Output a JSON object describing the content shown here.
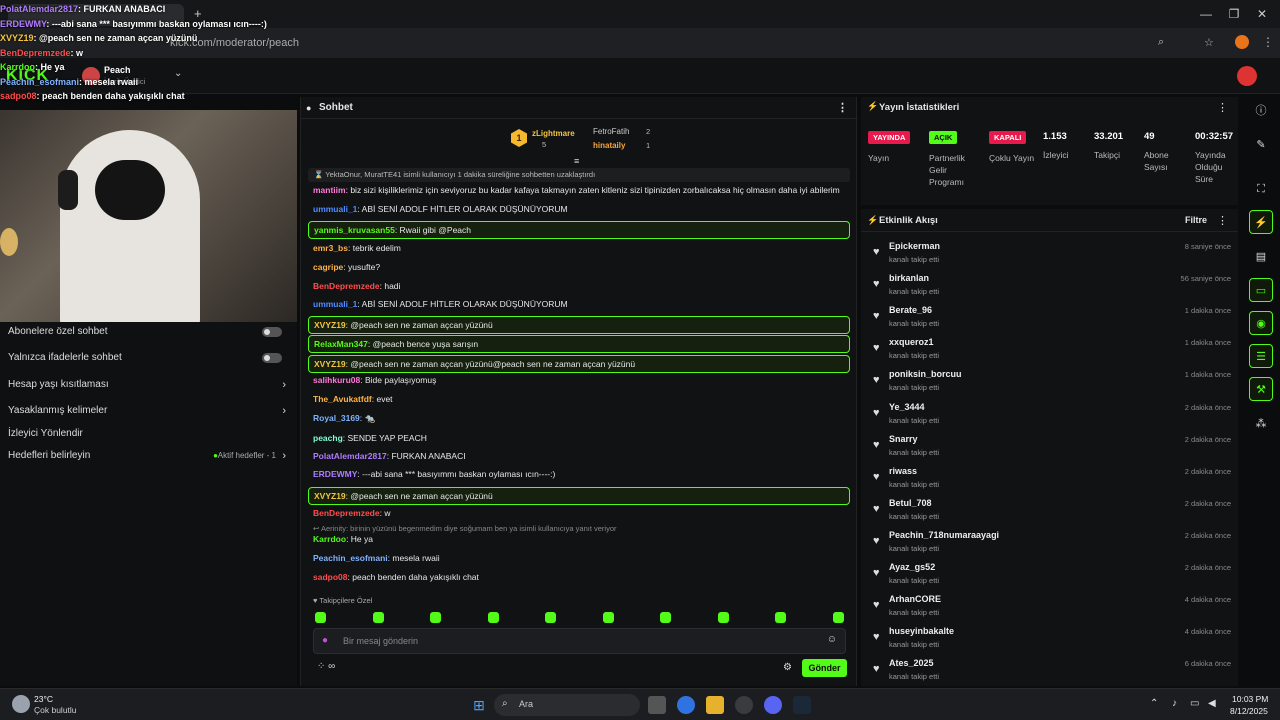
{
  "browser": {
    "tab_label": "PolatAlemdar2817: FURKAN ANABACI",
    "new_tab": "+",
    "url": "kick.com/moderator/peach",
    "controls": {
      "minimize": "—",
      "maximize": "❐",
      "close": "✕"
    }
  },
  "kick": {
    "logo": "KICK",
    "channel": "Peach",
    "channel_sub": "İçerik Üretici"
  },
  "overlay_chat": [
    {
      "user": "PolatAlemdar2817",
      "text": ": FURKAN ANABACI",
      "color": "#b07cff"
    },
    {
      "user": "ERDEWMY",
      "text": ": ---abi sana *** basıyımmı baskan oylaması ıcın----:)",
      "color": "#b07cff"
    },
    {
      "user": "XVYZ19",
      "text": ": @peach sen ne zaman açcan yüzünü",
      "color": "#f5c542"
    },
    {
      "user": "BenDepremzede",
      "text": ": w",
      "color": "#ff4d4d"
    },
    {
      "user": "Karrdoo",
      "text": ": He ya",
      "color": "#53fc18"
    },
    {
      "user": "Peachin_esofmani",
      "text": ": mesela rwaii",
      "color": "#7fb3ff"
    },
    {
      "user": "sadpo08",
      "text": ": peach benden daha yakışıklı chat",
      "color": "#ff4d4d"
    }
  ],
  "left_panel": {
    "items": [
      {
        "label": "Abonelere özel sohbet",
        "kind": "toggle"
      },
      {
        "label": "Yalnızca ifadelerle sohbet",
        "kind": "toggle"
      },
      {
        "label": "Hesap yaşı kısıtlaması",
        "kind": "chevron"
      },
      {
        "label": "Yasaklanmış kelimeler",
        "kind": "chevron"
      },
      {
        "label": "İzleyici Yönlendir",
        "kind": "none"
      },
      {
        "label": "Hedefleri belirleyin",
        "kind": "chevron",
        "extra": "Aktif hedefler - 1"
      }
    ]
  },
  "chat": {
    "title": "Sohbet",
    "top_gifters": [
      {
        "name": "zLightmare",
        "count": "5",
        "rank": "1"
      },
      {
        "name": "FetroFatih",
        "count": "2"
      },
      {
        "name": "hinataily",
        "count": "1"
      }
    ],
    "system_line": "YektaOnur, MuratTE41 isimli kullanıcıyı 1 dakika süreliğine sohbetten uzaklaştırdı",
    "messages": [
      {
        "user": "mantiim",
        "text": "biz sizi kişiliklerimiz için seviyoruz bu kadar kafaya takmayın zaten kitleniz sizi tipinizden zorbalıcaksa hiç olmasın daha iyi abilerim",
        "color": "#ff7ad9",
        "hl": false
      },
      {
        "user": "ummuali_1",
        "text": "ABİ SENİ ADOLF HİTLER OLARAK DÜŞÜNÜYORUM",
        "color": "#4f8cff",
        "hl": false
      },
      {
        "user": "yanmis_kruvasan55",
        "text": "Rwaii gibi @Peach",
        "color": "#53fc18",
        "hl": true
      },
      {
        "user": "emr3_bs",
        "text": "tebrik edelim",
        "color": "#ffb347",
        "hl": false
      },
      {
        "user": "cagripe",
        "text": "yusufte?",
        "color": "#ffb347",
        "hl": false
      },
      {
        "user": "BenDepremzede",
        "text": "hadi",
        "color": "#ff4d4d",
        "hl": false
      },
      {
        "user": "ummuali_1",
        "text": "ABİ SENİ ADOLF HİTLER OLARAK DÜŞÜNÜYORUM",
        "color": "#4f8cff",
        "hl": false
      },
      {
        "user": "XVYZ19",
        "text": "@peach sen ne zaman açcan yüzünü",
        "color": "#f5c542",
        "hl": true
      },
      {
        "user": "RelaxMan347",
        "text": "@peach bence yuşa sarışın",
        "color": "#53fc18",
        "hl": true
      },
      {
        "user": "XVYZ19",
        "text": "@peach sen ne zaman açcan yüzünü@peach sen ne zaman açcan yüzünü",
        "color": "#f5c542",
        "hl": true
      },
      {
        "user": "salihkuru08",
        "text": "Bide paylaşıyomuş",
        "color": "#ff7ad9",
        "hl": false
      },
      {
        "user": "The_Avukatfdf",
        "text": "evet",
        "color": "#ffb347",
        "hl": false
      },
      {
        "user": "Royal_3169",
        "text": "🐀",
        "color": "#7fb3ff",
        "hl": false
      },
      {
        "user": "peachg",
        "text": "SENDE YAP PEACH",
        "color": "#7fffd4",
        "hl": false
      },
      {
        "user": "PolatAlemdar2817",
        "text": "FURKAN ANABACI",
        "color": "#b07cff",
        "hl": false
      },
      {
        "user": "ERDEWMY",
        "text": "---abi sana *** basıyımmı baskan oylaması ıcın----:)",
        "color": "#b07cff",
        "hl": false
      },
      {
        "user": "XVYZ19",
        "text": "@peach sen ne zaman açcan yüzünü",
        "color": "#f5c542",
        "hl": true
      },
      {
        "user": "BenDepremzede",
        "text": "w",
        "color": "#ff4d4d",
        "hl": false
      }
    ],
    "reply_note": "Aerinity: birinin yüzünü begenmedim diye soğumam ben ya isimli kullanıcıya yanıt veriyor",
    "messages2": [
      {
        "user": "Karrdoo",
        "text": "He ya",
        "color": "#53fc18"
      },
      {
        "user": "Peachin_esofmani",
        "text": "mesela rwaii",
        "color": "#7fb3ff"
      },
      {
        "user": "sadpo08",
        "text": "peach benden daha yakışıklı chat",
        "color": "#ff4d4d"
      }
    ],
    "followers_only": "Takipçilere Özel",
    "input_placeholder": "Bir mesaj gönderin",
    "send_label": "Gönder",
    "accent": "#53fc18"
  },
  "stats": {
    "title": "Yayın İstatistikleri",
    "cols": [
      {
        "badge": "YAYINDA",
        "badge_color": "#e8194b",
        "label": "Yayın"
      },
      {
        "badge": "AÇIK",
        "badge_color": "#53fc18",
        "label": "Partnerlik Gelir Programı"
      },
      {
        "badge": "KAPALI",
        "badge_color": "#e8194b",
        "label": "Çoklu Yayın"
      },
      {
        "value": "1.153",
        "label": "İzleyici"
      },
      {
        "value": "33.201",
        "label": "Takipçi"
      },
      {
        "value": "49",
        "label": "Abone Sayısı"
      },
      {
        "value": "00:32:57",
        "label": "Yayında Olduğu Süre"
      }
    ]
  },
  "feed": {
    "title": "Etkinlik Akışı",
    "filter": "Filtre",
    "items": [
      {
        "name": "Epickerman",
        "sub": "kanalı takip etti",
        "time": "8 saniye önce"
      },
      {
        "name": "birkanlan",
        "sub": "kanalı takip etti",
        "time": "56 saniye önce"
      },
      {
        "name": "Berate_96",
        "sub": "kanalı takip etti",
        "time": "1 dakika önce"
      },
      {
        "name": "xxqueroz1",
        "sub": "kanalı takip etti",
        "time": "1 dakika önce"
      },
      {
        "name": "poniksin_borcuu",
        "sub": "kanalı takip etti",
        "time": "1 dakika önce"
      },
      {
        "name": "Ye_3444",
        "sub": "kanalı takip etti",
        "time": "2 dakika önce"
      },
      {
        "name": "Snarry",
        "sub": "kanalı takip etti",
        "time": "2 dakika önce"
      },
      {
        "name": "riwass",
        "sub": "kanalı takip etti",
        "time": "2 dakika önce"
      },
      {
        "name": "Betul_708",
        "sub": "kanalı takip etti",
        "time": "2 dakika önce"
      },
      {
        "name": "Peachin_718numaraayagi",
        "sub": "kanalı takip etti",
        "time": "2 dakika önce"
      },
      {
        "name": "Ayaz_gs52",
        "sub": "kanalı takip etti",
        "time": "2 dakika önce"
      },
      {
        "name": "ArhanCORE",
        "sub": "kanalı takip etti",
        "time": "4 dakika önce"
      },
      {
        "name": "huseyinbakalte",
        "sub": "kanalı takip etti",
        "time": "4 dakika önce"
      },
      {
        "name": "Ates_2025",
        "sub": "kanalı takip etti",
        "time": "6 dakika önce"
      }
    ]
  },
  "taskbar": {
    "weather_temp": "23°C",
    "weather_desc": "Çok bulutlu",
    "search": "Ara",
    "time": "10:03 PM",
    "date": "8/12/2025"
  }
}
